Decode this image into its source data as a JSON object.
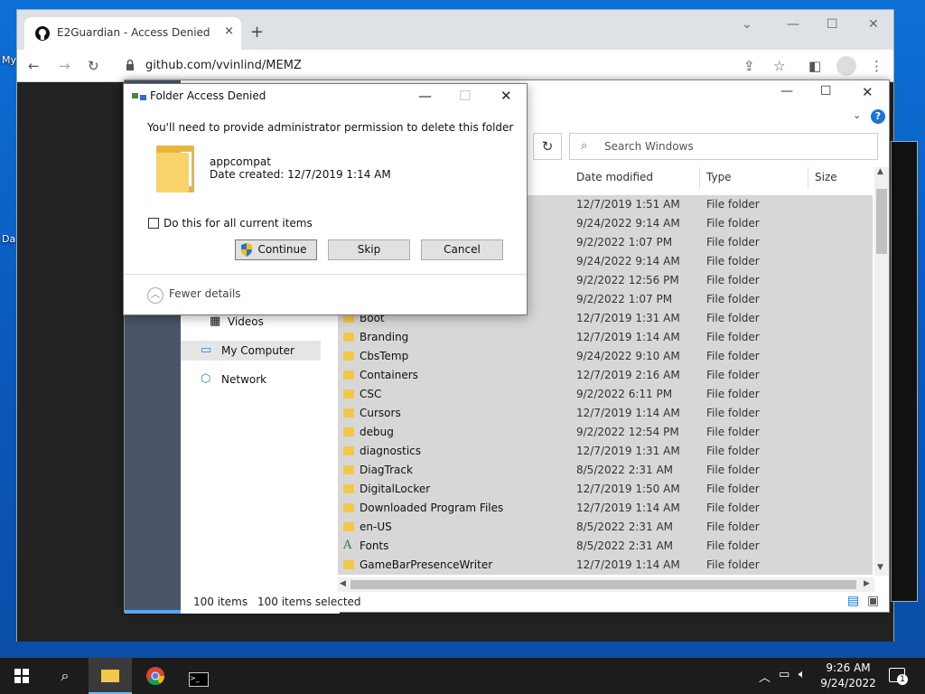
{
  "desktop": {
    "labels": [
      "My",
      "Da"
    ]
  },
  "browser": {
    "tab_title": "E2Guardian - Access Denied",
    "tab_close": "×",
    "new_tab": "+",
    "url": "github.com/vvinlind/MEMZ",
    "window_controls": [
      "⌄",
      "—",
      "☐",
      "✕"
    ]
  },
  "explorer": {
    "search_placeholder": "Search Windows",
    "columns": {
      "date": "Date modified",
      "type": "Type",
      "size": "Size"
    },
    "nav": [
      {
        "label": "Videos",
        "icon": "video-icon"
      },
      {
        "label": "My Computer",
        "icon": "computer-icon"
      },
      {
        "label": "Network",
        "icon": "network-icon"
      }
    ],
    "rows": [
      {
        "name": "",
        "date": "12/7/2019 1:51 AM",
        "type": "File folder"
      },
      {
        "name": "",
        "date": "9/24/2022 9:14 AM",
        "type": "File folder"
      },
      {
        "name": "",
        "date": "9/2/2022 1:07 PM",
        "type": "File folder"
      },
      {
        "name": "",
        "date": "9/24/2022 9:14 AM",
        "type": "File folder"
      },
      {
        "name": "",
        "date": "9/2/2022 12:56 PM",
        "type": "File folder"
      },
      {
        "name": "",
        "date": "9/2/2022 1:07 PM",
        "type": "File folder"
      },
      {
        "name": "Boot",
        "date": "12/7/2019 1:31 AM",
        "type": "File folder"
      },
      {
        "name": "Branding",
        "date": "12/7/2019 1:14 AM",
        "type": "File folder"
      },
      {
        "name": "CbsTemp",
        "date": "9/24/2022 9:10 AM",
        "type": "File folder"
      },
      {
        "name": "Containers",
        "date": "12/7/2019 2:16 AM",
        "type": "File folder"
      },
      {
        "name": "CSC",
        "date": "9/2/2022 6:11 PM",
        "type": "File folder"
      },
      {
        "name": "Cursors",
        "date": "12/7/2019 1:14 AM",
        "type": "File folder"
      },
      {
        "name": "debug",
        "date": "9/2/2022 12:54 PM",
        "type": "File folder"
      },
      {
        "name": "diagnostics",
        "date": "12/7/2019 1:31 AM",
        "type": "File folder"
      },
      {
        "name": "DiagTrack",
        "date": "8/5/2022 2:31 AM",
        "type": "File folder"
      },
      {
        "name": "DigitalLocker",
        "date": "12/7/2019 1:50 AM",
        "type": "File folder"
      },
      {
        "name": "Downloaded Program Files",
        "date": "12/7/2019 1:14 AM",
        "type": "File folder"
      },
      {
        "name": "en-US",
        "date": "8/5/2022 2:31 AM",
        "type": "File folder"
      },
      {
        "name": "Fonts",
        "date": "8/5/2022 2:31 AM",
        "type": "File folder",
        "icon": "font-icon"
      },
      {
        "name": "GameBarPresenceWriter",
        "date": "12/7/2019 1:14 AM",
        "type": "File folder"
      }
    ],
    "status_items": "100 items",
    "status_selected": "100 items selected"
  },
  "dialog": {
    "title": "Folder Access Denied",
    "message": "You'll need to provide administrator permission to delete this folder",
    "folder_name": "appcompat",
    "date_created": "Date created: 12/7/2019 1:14 AM",
    "checkbox_label": "Do this for all current items",
    "continue": "Continue",
    "skip": "Skip",
    "cancel": "Cancel",
    "fewer_details": "Fewer details"
  },
  "taskbar": {
    "time": "9:26 AM",
    "date": "9/24/2022",
    "notification_count": "1"
  }
}
